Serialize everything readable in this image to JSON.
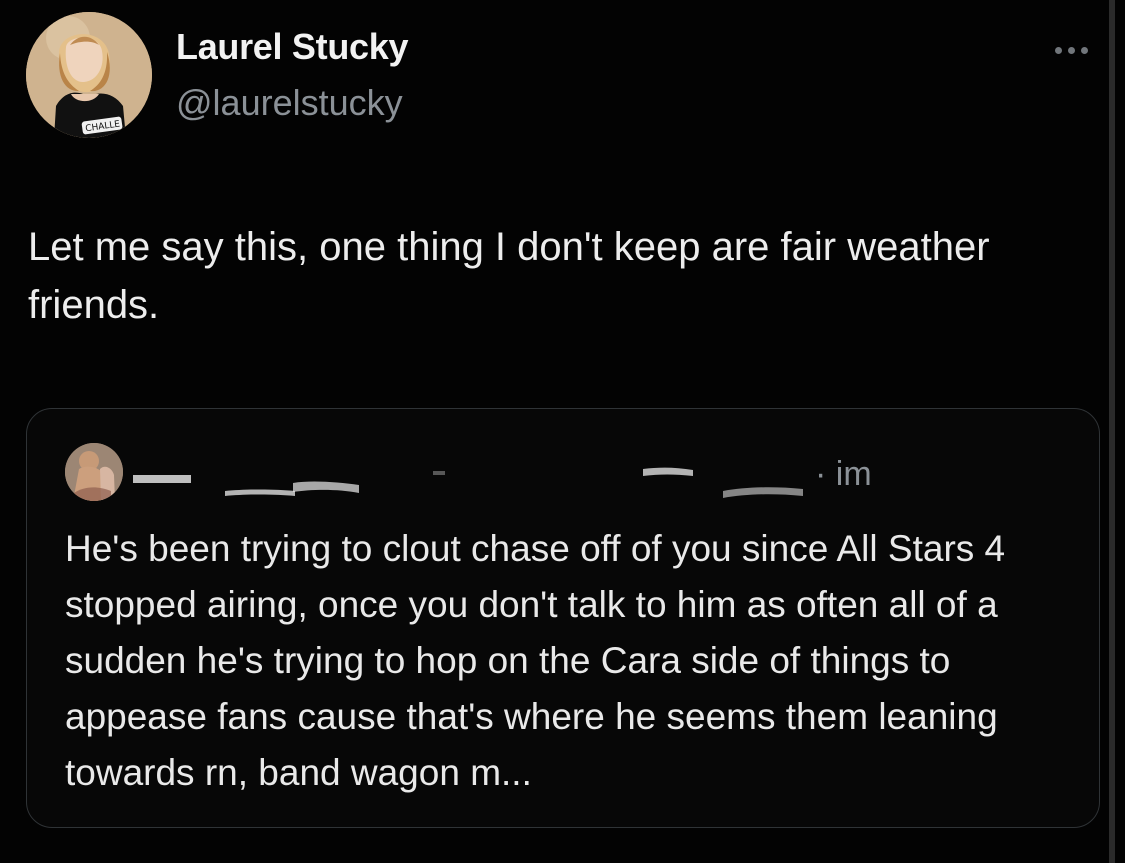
{
  "author": {
    "display_name": "Laurel Stucky",
    "handle": "@laurelstucky",
    "avatar_icon": "profile-photo",
    "avatar_badge_text": "CHALLE"
  },
  "menu": {
    "icon": "more-horizontal-icon"
  },
  "tweet": {
    "text": "Let me say this, one thing I don't keep are fair weather friends."
  },
  "quoted_tweet": {
    "author_name": "",
    "timestamp": "· im",
    "avatar_icon": "profile-photo",
    "text": "He's been trying to clout chase off of you since All Stars 4 stopped airing, once you don't talk to him as often all of a sudden he's trying to hop on the Cara side of things to appease fans cause that's where he seems them leaning towards rn, band wagon m..."
  },
  "colors": {
    "background": "#000000",
    "primary_text": "#e7e9ea",
    "secondary_text": "#8b9197",
    "border": "#2f3336"
  }
}
